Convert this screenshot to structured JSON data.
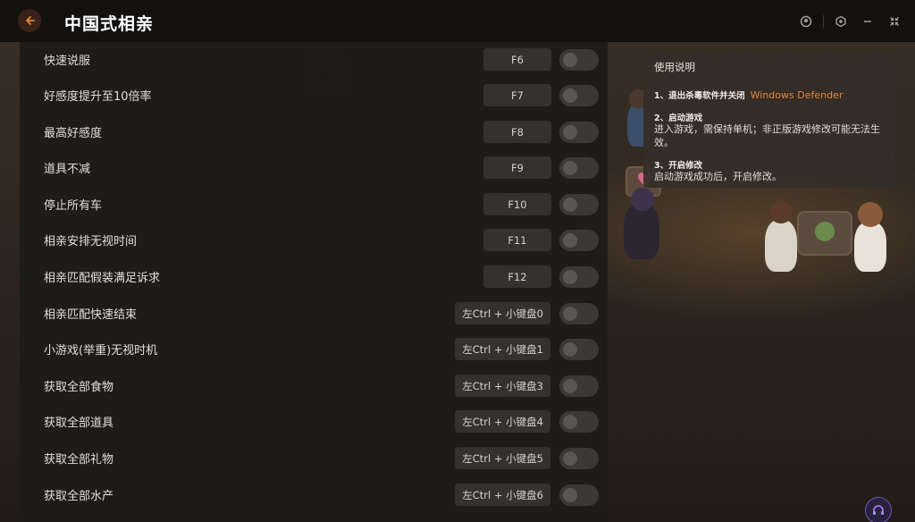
{
  "app": {
    "title": "中国式相亲",
    "accent_color": "#e2863a"
  },
  "cheats": [
    {
      "label": "快速说服",
      "hotkey": "F6",
      "enabled": false
    },
    {
      "label": "好感度提升至10倍率",
      "hotkey": "F7",
      "enabled": false
    },
    {
      "label": "最高好感度",
      "hotkey": "F8",
      "enabled": false
    },
    {
      "label": "道具不减",
      "hotkey": "F9",
      "enabled": false
    },
    {
      "label": "停止所有车",
      "hotkey": "F10",
      "enabled": false
    },
    {
      "label": "相亲安排无视时间",
      "hotkey": "F11",
      "enabled": false
    },
    {
      "label": "相亲匹配假装满足诉求",
      "hotkey": "F12",
      "enabled": false
    },
    {
      "label": "相亲匹配快速结束",
      "hotkey": "左Ctrl + 小键盘0",
      "enabled": false
    },
    {
      "label": "小游戏(举重)无视时机",
      "hotkey": "左Ctrl + 小键盘1",
      "enabled": false
    },
    {
      "label": "获取全部食物",
      "hotkey": "左Ctrl + 小键盘3",
      "enabled": false
    },
    {
      "label": "获取全部道具",
      "hotkey": "左Ctrl + 小键盘4",
      "enabled": false
    },
    {
      "label": "获取全部礼物",
      "hotkey": "左Ctrl + 小键盘5",
      "enabled": false
    },
    {
      "label": "获取全部水产",
      "hotkey": "左Ctrl + 小键盘6",
      "enabled": false
    }
  ],
  "instructions": {
    "title": "使用说明",
    "step1_title": "1、退出杀毒软件并关闭",
    "step1_highlight": "Windows Defender",
    "step2_title": "2、启动游戏",
    "step2_body": "进入游戏，需保持单机；非正版游戏修改可能无法生效。",
    "step3_title": "3、开启修改",
    "step3_body": "启动游戏成功后，开启修改。"
  },
  "icons": {
    "back": "back-arrow-icon",
    "user": "user-icon",
    "settings": "settings-icon",
    "minimize": "minimize-icon",
    "collapse": "collapse-icon",
    "support": "headset-icon"
  }
}
